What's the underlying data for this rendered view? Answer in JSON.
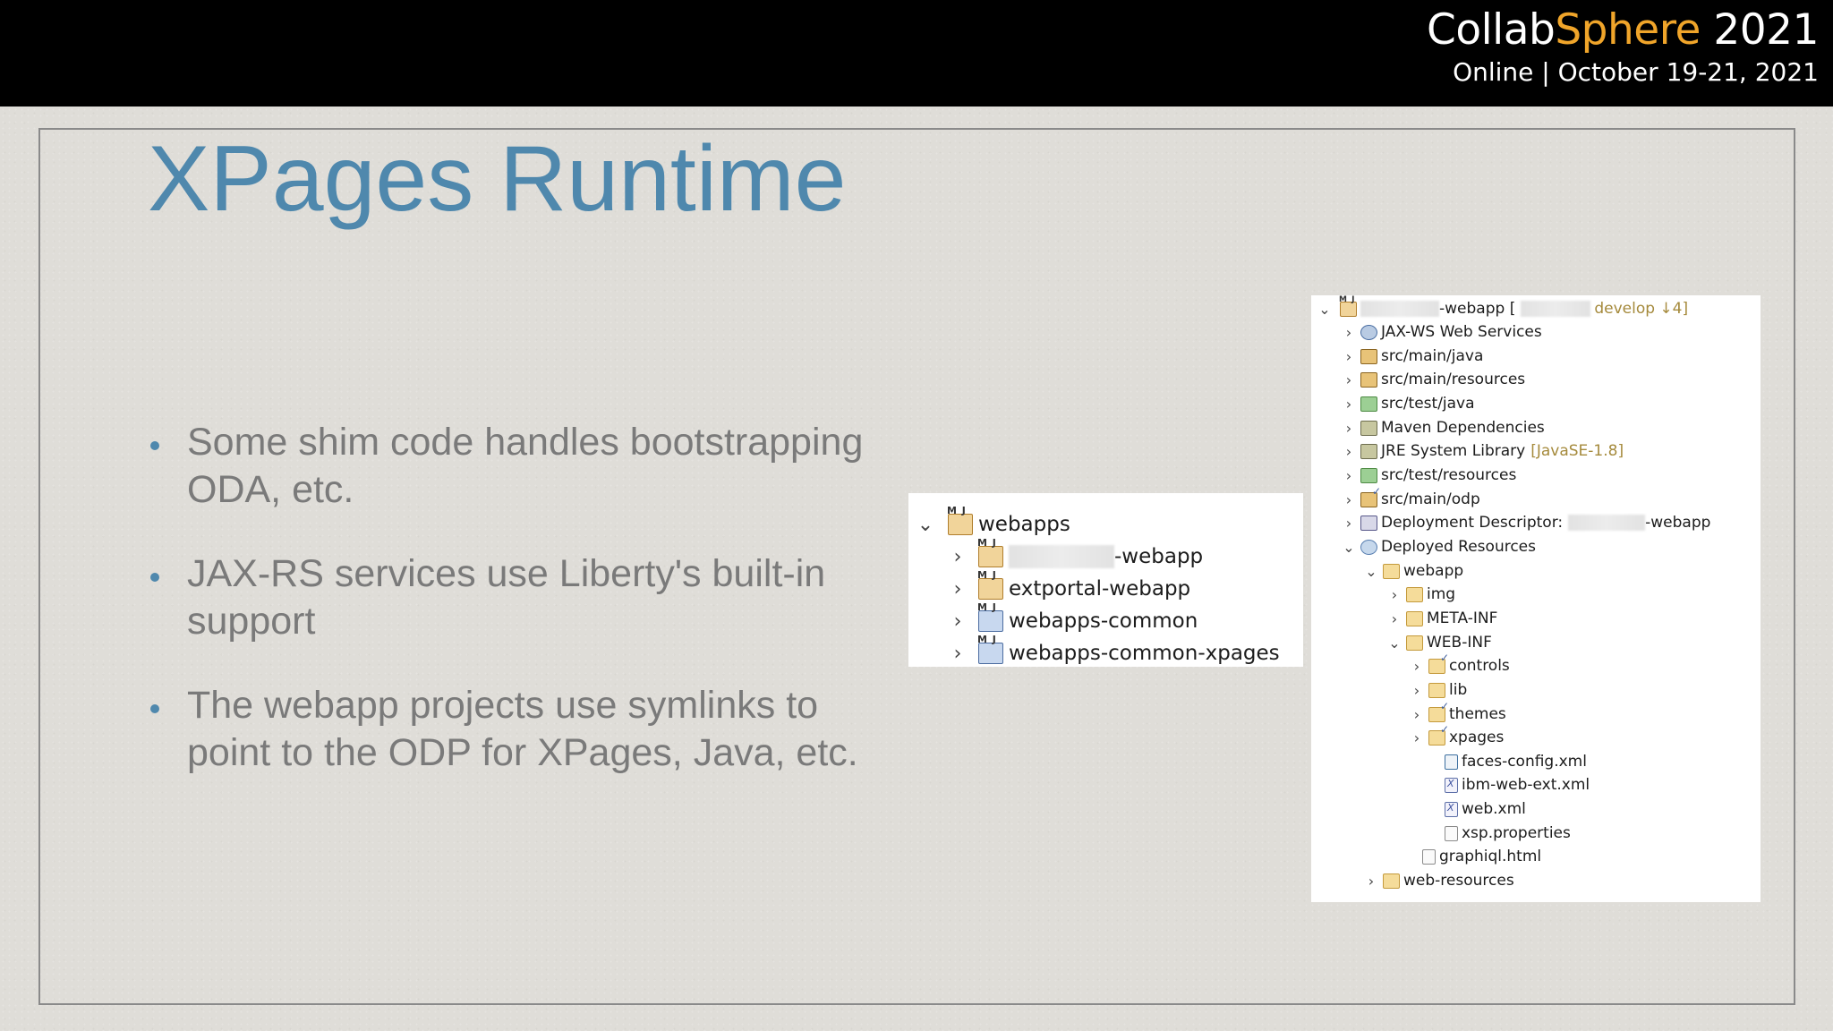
{
  "header": {
    "brand_part1": "Collab",
    "brand_part2": "Sphere",
    "brand_year": " 2021",
    "subtitle": "Online | October 19-21, 2021",
    "accent_color": "#f0a52a"
  },
  "slide": {
    "title": "XPages Runtime",
    "title_color": "#4f88ad",
    "bullets": [
      "Some shim code handles bootstrapping\nODA, etc.",
      "JAX-RS services use Liberty's built-in\nsupport",
      "The webapp projects use symlinks to\npoint to the ODP for XPages, Java, etc."
    ]
  },
  "workspace_panel": {
    "items": [
      {
        "label": "webapps",
        "expanded": true,
        "icon": "project-folder-icon"
      },
      {
        "label": "-webapp",
        "expanded": false,
        "icon": "maven-project-icon",
        "redacted_prefix": true
      },
      {
        "label": "extportal-webapp",
        "expanded": false,
        "icon": "maven-project-icon"
      },
      {
        "label": "webapps-common",
        "expanded": false,
        "icon": "maven-project-icon"
      },
      {
        "label": "webapps-common-xpages",
        "expanded": false,
        "icon": "maven-project-icon"
      }
    ]
  },
  "project_panel": {
    "root_label": "-webapp [",
    "root_branch": "develop ↓4]",
    "items": [
      {
        "label": "JAX-WS Web Services",
        "decoration": "",
        "icon": "web-services-icon"
      },
      {
        "label": "src/main/java",
        "decoration": "",
        "icon": "source-folder-icon"
      },
      {
        "label": "src/main/resources",
        "decoration": "",
        "icon": "source-folder-icon"
      },
      {
        "label": "src/test/java",
        "decoration": "",
        "icon": "test-source-folder-icon"
      },
      {
        "label": "Maven Dependencies",
        "decoration": "",
        "icon": "library-icon"
      },
      {
        "label": "JRE System Library",
        "decoration": "[JavaSE-1.8]",
        "icon": "library-icon"
      },
      {
        "label": "src/test/resources",
        "decoration": "",
        "icon": "test-source-folder-icon"
      },
      {
        "label": "src/main/odp",
        "decoration": "",
        "icon": "source-folder-icon"
      },
      {
        "label": "Deployment Descriptor:",
        "decoration": "-webapp",
        "icon": "deployment-descriptor-icon"
      },
      {
        "label": "Deployed Resources",
        "decoration": "",
        "icon": "deployed-resources-icon"
      },
      {
        "label": "webapp",
        "decoration": "",
        "icon": "folder-icon"
      },
      {
        "label": "img",
        "decoration": "",
        "icon": "folder-icon"
      },
      {
        "label": "META-INF",
        "decoration": "",
        "icon": "folder-icon"
      },
      {
        "label": "WEB-INF",
        "decoration": "",
        "icon": "folder-icon"
      },
      {
        "label": "controls",
        "decoration": "",
        "icon": "linked-folder-icon"
      },
      {
        "label": "lib",
        "decoration": "",
        "icon": "folder-icon"
      },
      {
        "label": "themes",
        "decoration": "",
        "icon": "linked-folder-icon"
      },
      {
        "label": "xpages",
        "decoration": "",
        "icon": "linked-folder-icon"
      },
      {
        "label": "faces-config.xml",
        "decoration": "",
        "icon": "faces-config-icon"
      },
      {
        "label": "ibm-web-ext.xml",
        "decoration": "",
        "icon": "xml-file-icon"
      },
      {
        "label": "web.xml",
        "decoration": "",
        "icon": "xml-file-icon"
      },
      {
        "label": "xsp.properties",
        "decoration": "",
        "icon": "properties-file-icon"
      },
      {
        "label": "graphiql.html",
        "decoration": "",
        "icon": "html-file-icon"
      },
      {
        "label": "web-resources",
        "decoration": "",
        "icon": "folder-icon"
      }
    ]
  }
}
